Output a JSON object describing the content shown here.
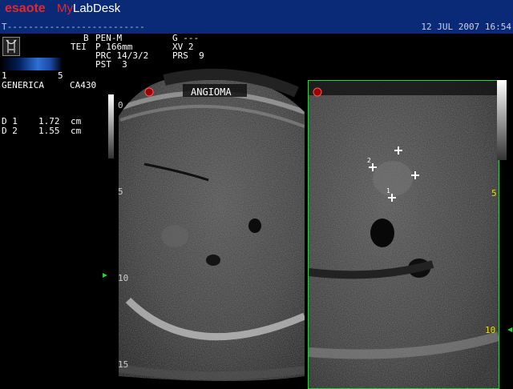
{
  "app": {
    "brand": "esaote",
    "product_my": "My",
    "product_rest": "LabDesk"
  },
  "status_line": "T--------------------------",
  "date": "12 JUL 2007 16:54",
  "params": {
    "col1": [
      "B",
      "TEI"
    ],
    "col2": [
      "PEN-M",
      "P 166mm",
      "PRC 14/3/2",
      "PST  3"
    ],
    "col3": [
      "G ---",
      "XV 2",
      "PRS  9"
    ]
  },
  "colorbar_ticks": [
    "1",
    "5"
  ],
  "preset": {
    "name": "GENERICA",
    "probe": "CA430"
  },
  "measurements": [
    {
      "label": "D 1",
      "value": "1.72",
      "unit": "cm"
    },
    {
      "label": "D 2",
      "value": "1.55",
      "unit": "cm"
    }
  ],
  "image_left": {
    "annotation": "ANGIOMA",
    "depth_ticks": [
      "0",
      "5",
      "10",
      "15"
    ]
  },
  "image_right": {
    "depth_ticks": [
      "5",
      "10"
    ],
    "caliper_labels": [
      "2",
      "1"
    ]
  },
  "colors": {
    "titlebar": "#0a2a78",
    "brand_red": "#e8262a",
    "frame_green": "#2ecc40",
    "depth_yellow": "#e8e000"
  }
}
